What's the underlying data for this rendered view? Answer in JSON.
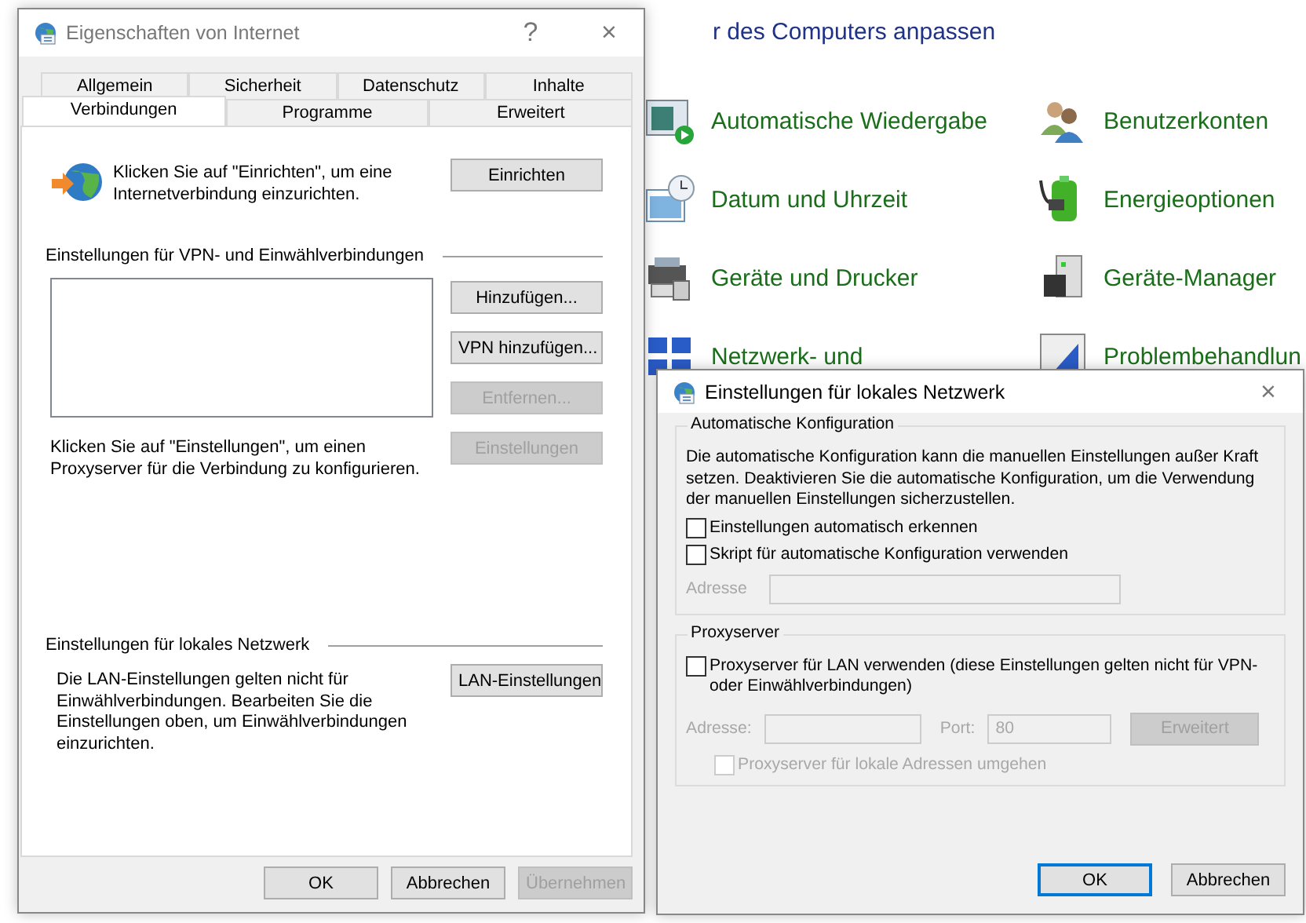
{
  "background": {
    "heading": "r des Computers anpassen",
    "items": [
      {
        "label": "Automatische Wiedergabe"
      },
      {
        "label": "Benutzerkonten"
      },
      {
        "label": "Datum und Uhrzeit"
      },
      {
        "label": "Energieoptionen"
      },
      {
        "label": "Geräte und Drucker"
      },
      {
        "label": "Geräte-Manager"
      },
      {
        "label": "Netzwerk- und"
      },
      {
        "label": "Problembehandlun"
      }
    ]
  },
  "internet_options": {
    "title": "Eigenschaften von Internet",
    "help": "?",
    "close": "×",
    "tab_rows": [
      [
        {
          "label": "Allgemein",
          "selected": false
        },
        {
          "label": "Sicherheit",
          "selected": false
        },
        {
          "label": "Datenschutz",
          "selected": false
        },
        {
          "label": "Inhalte",
          "selected": false
        }
      ],
      [
        {
          "label": "Verbindungen",
          "selected": true
        },
        {
          "label": "Programme",
          "selected": false
        },
        {
          "label": "Erweitert",
          "selected": false
        }
      ]
    ],
    "setup_text": "Klicken Sie auf \"Einrichten\", um eine Internetverbindung einzurichten.",
    "setup_button": "Einrichten",
    "vpn_section": "Einstellungen für VPN- und Einwählverbindungen",
    "vpn_buttons": [
      {
        "label": "Hinzufügen...",
        "disabled": false
      },
      {
        "label": "VPN hinzufügen...",
        "disabled": false
      },
      {
        "label": "Entfernen...",
        "disabled": true
      },
      {
        "label": "Einstellungen",
        "disabled": true
      }
    ],
    "proxy_text": "Klicken Sie auf \"Einstellungen\", um einen Proxyserver für die Verbindung zu konfigurieren.",
    "lan_section": "Einstellungen für lokales Netzwerk",
    "lan_text": "Die LAN-Einstellungen gelten nicht für Einwählverbindungen. Bearbeiten Sie die Einstellungen oben, um Einwählverbindungen einzurichten.",
    "lan_button": "LAN-Einstellungen",
    "buttons": [
      {
        "label": "OK",
        "disabled": false
      },
      {
        "label": "Abbrechen",
        "disabled": false
      },
      {
        "label": "Übernehmen",
        "disabled": true
      }
    ]
  },
  "lan_dialog": {
    "title": "Einstellungen für lokales Netzwerk",
    "close": "×",
    "auto_group": "Automatische Konfiguration",
    "auto_text": "Die automatische Konfiguration kann die manuellen Einstellungen außer Kraft setzen. Deaktivieren Sie die automatische Konfiguration, um die Verwendung der manuellen Einstellungen sicherzustellen.",
    "auto_options": [
      {
        "label": "Einstellungen automatisch erkennen",
        "checked": false
      },
      {
        "label": "Skript für automatische Konfiguration verwenden",
        "checked": false
      }
    ],
    "script_address_label": "Adresse",
    "proxy_group": "Proxyserver",
    "proxy_option": {
      "label": "Proxyserver für LAN verwenden (diese Einstellungen gelten nicht für VPN- oder Einwählverbindungen)",
      "checked": false
    },
    "address_label": "Adresse:",
    "port_label": "Port:",
    "port_value": "80",
    "advanced_button": "Erweitert",
    "bypass_option": {
      "label": "Proxyserver für lokale Adressen umgehen",
      "checked": false
    },
    "buttons": [
      {
        "label": "OK",
        "default": true
      },
      {
        "label": "Abbrechen",
        "default": false
      }
    ]
  }
}
